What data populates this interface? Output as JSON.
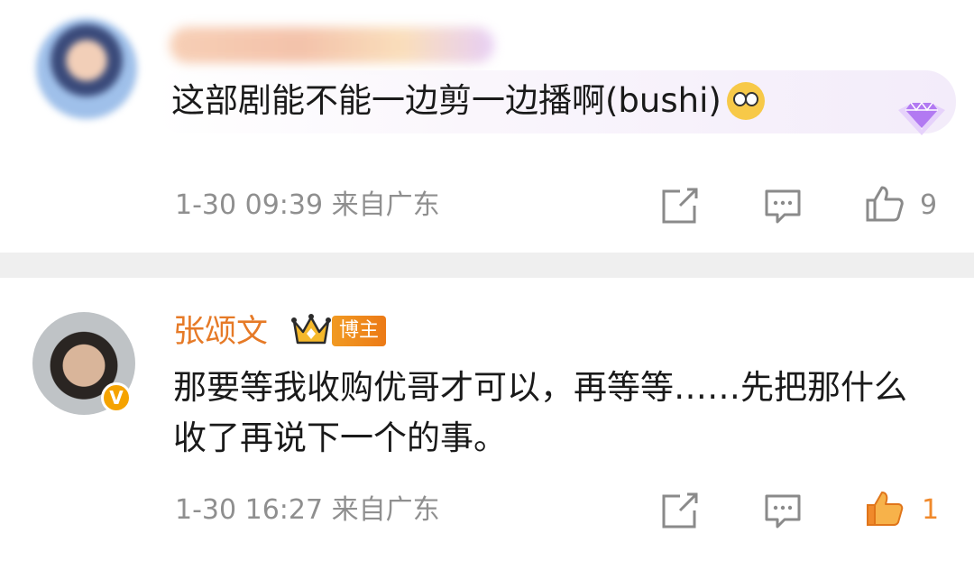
{
  "comments": [
    {
      "text": "这部剧能不能一边剪一边播啊(bushi)",
      "emoji": "pleading-face-emoji",
      "timestamp": "1-30 09:39",
      "location": "来自广东",
      "like_count": "9",
      "liked": false
    },
    {
      "username": "张颂文",
      "badge": "博主",
      "verified_mark": "V",
      "text": "那要等我收购优哥才可以，再等等……先把那什么收了再说下一个的事。",
      "timestamp": "1-30 16:27",
      "location": "来自广东",
      "like_count": "1",
      "liked": true
    }
  ],
  "colors": {
    "username": "#e67a27",
    "meta_text": "#8f8f8f",
    "divider": "#efefef",
    "liked": "#f0892b",
    "icon_gray": "#8a8a8a"
  }
}
